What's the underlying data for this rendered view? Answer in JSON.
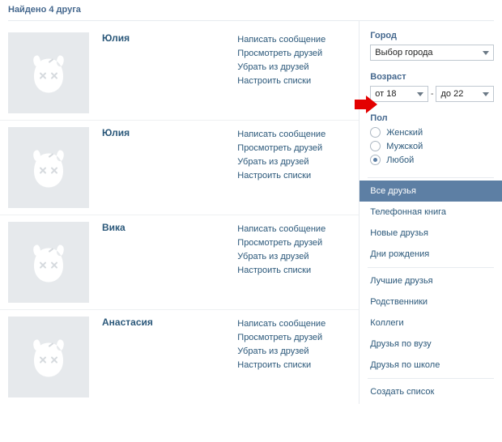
{
  "header": {
    "title": "Найдено 4 друга"
  },
  "friends": [
    {
      "name": "Юлия",
      "actions": [
        "Написать сообщение",
        "Просмотреть друзей",
        "Убрать из друзей",
        "Настроить списки"
      ]
    },
    {
      "name": "Юлия",
      "actions": [
        "Написать сообщение",
        "Просмотреть друзей",
        "Убрать из друзей",
        "Настроить списки"
      ]
    },
    {
      "name": "Вика",
      "actions": [
        "Написать сообщение",
        "Просмотреть друзей",
        "Убрать из друзей",
        "Настроить списки"
      ]
    },
    {
      "name": "Анастасия",
      "actions": [
        "Написать сообщение",
        "Просмотреть друзей",
        "Убрать из друзей",
        "Настроить списки"
      ]
    }
  ],
  "sidebar": {
    "city": {
      "label": "Город",
      "value": "Выбор города"
    },
    "age": {
      "label": "Возраст",
      "from": "от 18",
      "to": "до 22"
    },
    "sex": {
      "label": "Пол",
      "options": [
        {
          "label": "Женский",
          "checked": false
        },
        {
          "label": "Мужской",
          "checked": false
        },
        {
          "label": "Любой",
          "checked": true
        }
      ]
    },
    "lists1": [
      {
        "label": "Все друзья",
        "active": true
      },
      {
        "label": "Телефонная книга",
        "active": false
      },
      {
        "label": "Новые друзья",
        "active": false
      },
      {
        "label": "Дни рождения",
        "active": false
      }
    ],
    "lists2": [
      {
        "label": "Лучшие друзья"
      },
      {
        "label": "Родственники"
      },
      {
        "label": "Коллеги"
      },
      {
        "label": "Друзья по вузу"
      },
      {
        "label": "Друзья по школе"
      }
    ],
    "create": {
      "label": "Создать список"
    }
  }
}
